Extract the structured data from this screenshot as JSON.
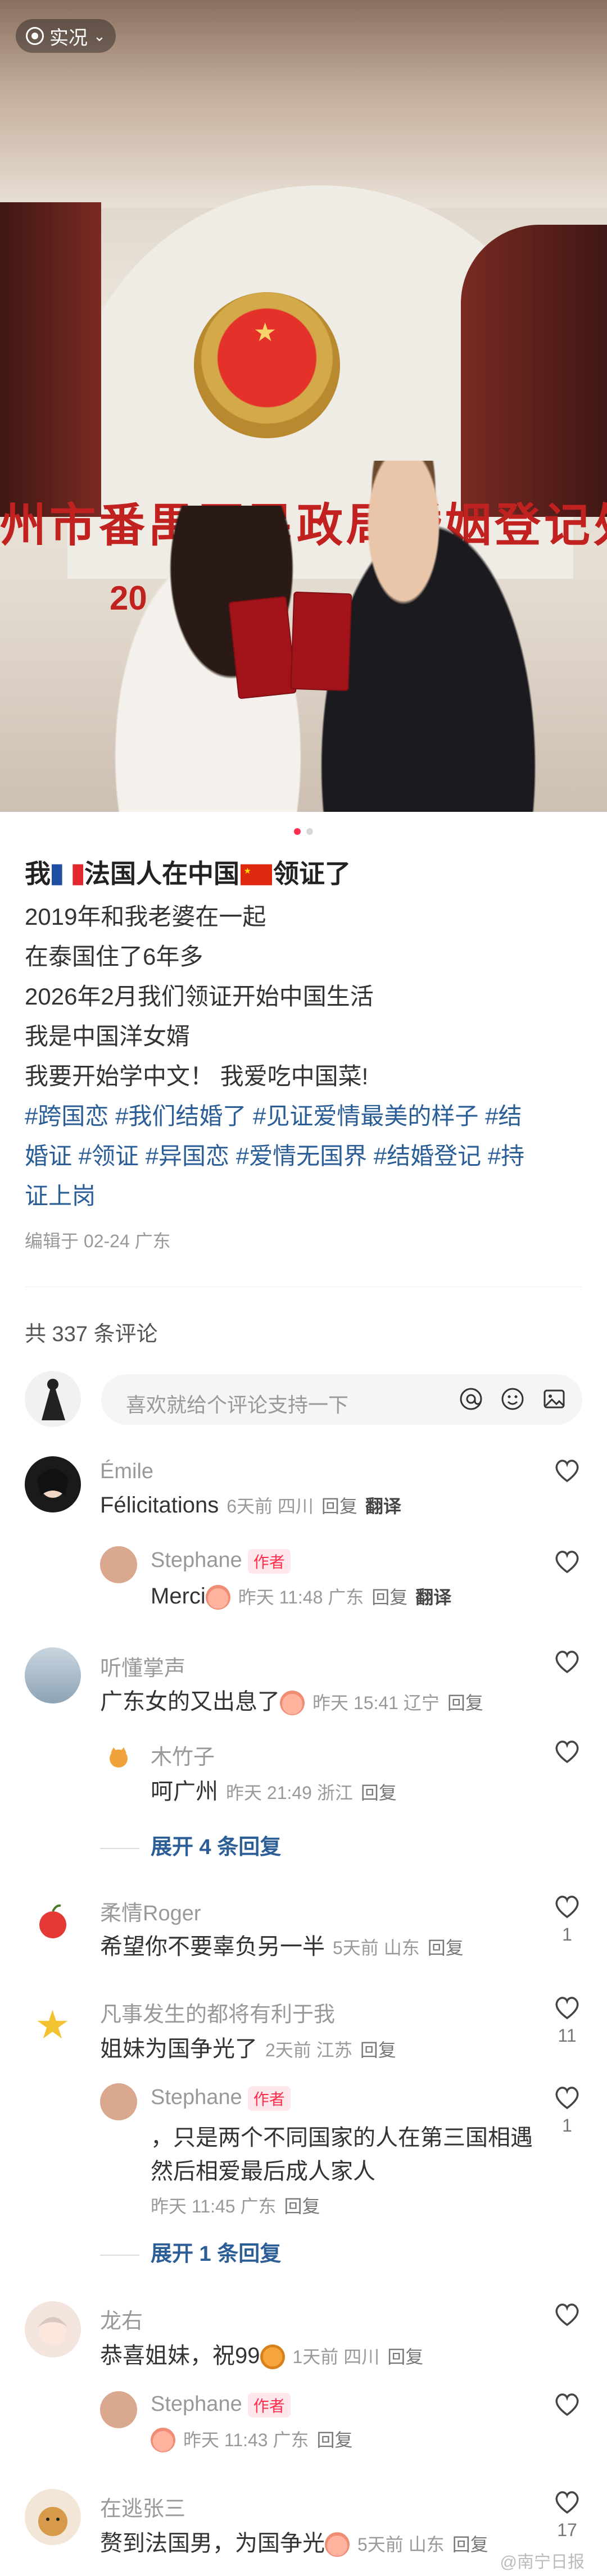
{
  "photo": {
    "live_badge": "实况",
    "wall_sign": "州市番禺区民政局婚姻登记处",
    "wall_year": "20"
  },
  "post": {
    "title_prefix": "我",
    "title_mid": "法国人在中国",
    "title_suffix": "领证了",
    "lines": [
      "2019年和我老婆在一起",
      "在泰国住了6年多",
      "2026年2月我们领证开始中国生活",
      "我是中国洋女婿",
      "我要开始学中文！ 我爱吃中国菜!"
    ],
    "tags_line1": "#跨国恋 #我们结婚了 #见证爱情最美的样子 #结",
    "tags_line2": "婚证 #领证 #异国恋 #爱情无国界 #结婚登记 #持",
    "tags_line3": "证上岗",
    "edited": "编辑于 02-24  广东"
  },
  "comments_header": {
    "count_text": "共 337 条评论",
    "placeholder": "喜欢就给个评论支持一下"
  },
  "ui": {
    "reply": "回复",
    "translate": "翻译",
    "author_tag": "作者"
  },
  "comments": [
    {
      "user": "Émile",
      "text": "Félicitations",
      "meta": "6天前  四川",
      "like": ""
    },
    {
      "user": "Stephane",
      "text": "Merci",
      "meta": "昨天 11:48  广东",
      "like": ""
    },
    {
      "user": "听懂掌声",
      "text": "广东女的又出息了",
      "meta": "昨天 15:41  辽宁",
      "like": ""
    },
    {
      "user": "木竹子",
      "text": "呵广州",
      "meta": "昨天 21:49  浙江",
      "like": ""
    },
    {
      "expand": "展开 4 条回复"
    },
    {
      "user": "柔情Roger",
      "text": "希望你不要辜负另一半",
      "meta": "5天前  山东",
      "like": "1"
    },
    {
      "user": "凡事发生的都将有利于我",
      "text": "姐妹为国争光了",
      "meta": "2天前  江苏",
      "like": "11"
    },
    {
      "user": "Stephane",
      "text1": "，只是两个不同国家的人在第三国相遇",
      "text2": "然后相爱最后成人家人",
      "meta": "昨天 11:45  广东",
      "like": "1"
    },
    {
      "expand": "展开 1 条回复"
    },
    {
      "user": "龙右",
      "text": "恭喜姐妹，祝99",
      "meta": "1天前  四川",
      "like": ""
    },
    {
      "user": "Stephane",
      "text": "",
      "meta": "昨天 11:43  广东",
      "like": ""
    },
    {
      "user": "在逃张三",
      "text": "赘到法国男，为国争光",
      "meta": "5天前  山东",
      "like": "17"
    }
  ],
  "watermark": "@南宁日报"
}
